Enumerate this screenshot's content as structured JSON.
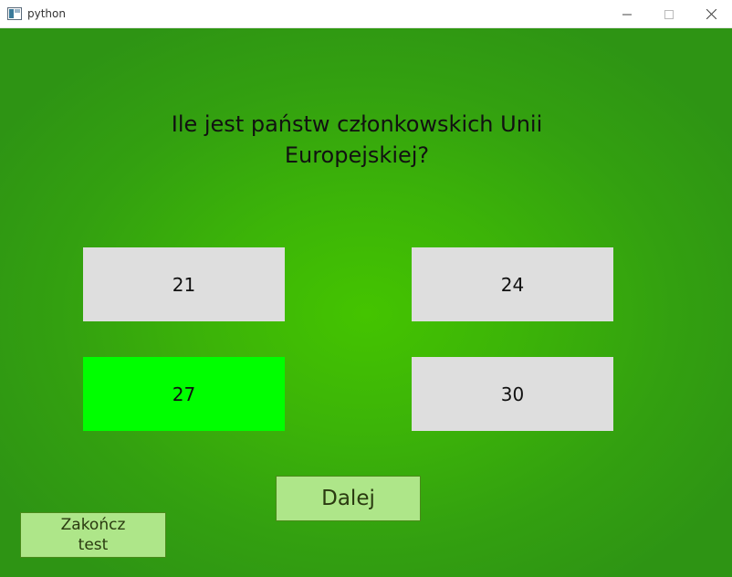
{
  "window": {
    "title": "python",
    "icons": {
      "app": "app-window-icon",
      "minimize": "minimize-icon",
      "maximize": "maximize-icon",
      "close": "close-icon"
    }
  },
  "quiz": {
    "question": "Ile jest państw członkowskich Unii Europejskiej?",
    "answers": [
      {
        "label": "21",
        "state": "default"
      },
      {
        "label": "24",
        "state": "default"
      },
      {
        "label": "27",
        "state": "correct"
      },
      {
        "label": "30",
        "state": "default"
      }
    ],
    "next_label": "Dalej",
    "end_label": "Zakończ test"
  },
  "colors": {
    "background": "#3cb408",
    "answer_default": "#dedede",
    "answer_correct": "#00ff00",
    "button": "#aee689"
  }
}
